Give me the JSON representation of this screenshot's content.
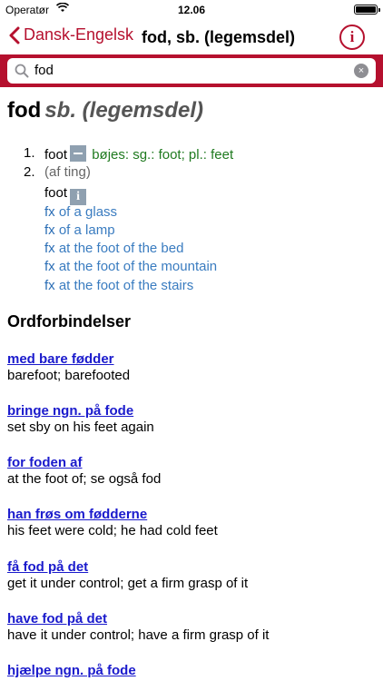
{
  "status": {
    "carrier": "Operatør",
    "time": "12.06",
    "battery_level": 1.0
  },
  "nav": {
    "back_label": "Dansk-Engelsk",
    "title": "fod, sb. (legemsdel)",
    "info_label": "i"
  },
  "search": {
    "query": "fod",
    "clear_label": "×"
  },
  "entry": {
    "headword": "fod",
    "grammar": "sb. (legemsdel)",
    "senses": [
      {
        "number": "1.",
        "translation": "foot",
        "inflection": "bøjes: sg.: foot; pl.: feet"
      },
      {
        "number": "2.",
        "context": "(af ting)",
        "translation": "foot",
        "examples": [
          {
            "prefix": "fx",
            "text": "of a glass"
          },
          {
            "prefix": "fx",
            "text": "of a lamp"
          },
          {
            "prefix": "fx",
            "text": "at the foot of the bed"
          },
          {
            "prefix": "fx",
            "text": "at the foot of the mountain"
          },
          {
            "prefix": "fx",
            "text": "at the foot of the stairs"
          }
        ]
      }
    ]
  },
  "section_title": "Ordforbindelser",
  "phrases": [
    {
      "link": "med bare fødder",
      "text": "barefoot; barefooted"
    },
    {
      "link": "bringe ngn. på fode",
      "text": "set sby on his feet again"
    },
    {
      "link": "for foden af",
      "text": "at the foot of; se også fod"
    },
    {
      "link": "han frøs om fødderne",
      "text": "his feet were cold; he had cold feet"
    },
    {
      "link": "få fod på det",
      "text": "get it under control; get a firm grasp of it"
    },
    {
      "link": "have fod på det",
      "text": "have it under control; have a firm grasp of it"
    },
    {
      "link": "hjælpe ngn. på fode",
      "text": ""
    }
  ],
  "colors": {
    "accent": "#b5102e",
    "link": "#1a1acc",
    "example": "#3a7cc0",
    "inflection": "#1f7a1f"
  }
}
